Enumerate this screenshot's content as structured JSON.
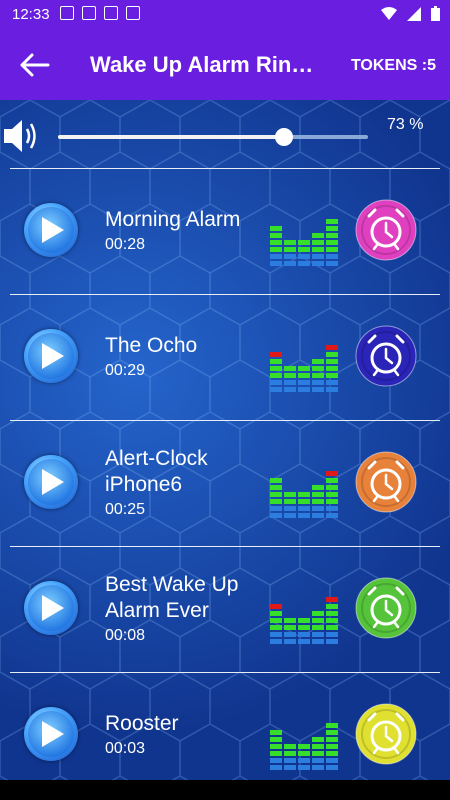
{
  "status": {
    "time": "12:33"
  },
  "appbar": {
    "title": "Wake Up Alarm Rin…",
    "tokens": "TOKENS :5"
  },
  "volume": {
    "percent_label": "73 %",
    "level": 0.73
  },
  "rings": [
    {
      "name": "Morning Alarm",
      "duration": "00:28",
      "alarm_color": "#e040c0",
      "eq": [
        0,
        0,
        0,
        0,
        0
      ]
    },
    {
      "name": "The Ocho",
      "duration": "00:29",
      "alarm_color": "#2a24b8",
      "eq": [
        1,
        0,
        0,
        0,
        1
      ]
    },
    {
      "name": "Alert-Clock iPhone6",
      "duration": "00:25",
      "alarm_color": "#e8813a",
      "eq": [
        0,
        0,
        0,
        0,
        1
      ]
    },
    {
      "name": "Best Wake Up Alarm Ever",
      "duration": "00:08",
      "alarm_color": "#55c43a",
      "eq": [
        1,
        0,
        0,
        0,
        1
      ]
    },
    {
      "name": "Rooster",
      "duration": "00:03",
      "alarm_color": "#e0e030",
      "eq": [
        0,
        0,
        0,
        0,
        0
      ]
    }
  ]
}
